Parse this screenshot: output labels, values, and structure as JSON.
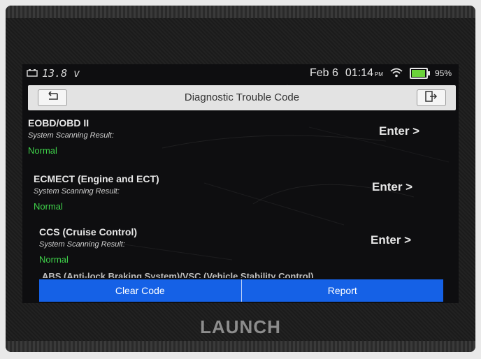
{
  "statusbar": {
    "voltage": "13.8 v",
    "date": "Feb 6",
    "time": "01:14",
    "time_suffix": "PM",
    "battery_percent_text": "95%",
    "battery_level": 0.95
  },
  "header": {
    "title": "Diagnostic Trouble Code"
  },
  "systems": [
    {
      "name": "EOBD/OBD II",
      "label": "System Scanning Result:",
      "result": "Normal",
      "enter": "Enter >"
    },
    {
      "name": "ECMECT (Engine and ECT)",
      "label": "System Scanning Result:",
      "result": "Normal",
      "enter": "Enter >"
    },
    {
      "name": "CCS (Cruise Control)",
      "label": "System Scanning Result:",
      "result": "Normal",
      "enter": "Enter >"
    },
    {
      "name": "ABS (Anti-lock Braking System)/VSC (Vehicle Stability Control)"
    }
  ],
  "actions": {
    "clear_code": "Clear Code",
    "report": "Report"
  },
  "brand": "LAUNCH",
  "colors": {
    "accent_blue": "#1561e6",
    "normal_green": "#3fd24a",
    "battery_green": "#6bd23a"
  },
  "icons": [
    "battery-car-icon",
    "wifi-icon",
    "battery-icon",
    "back-arrow-icon",
    "exit-icon"
  ]
}
